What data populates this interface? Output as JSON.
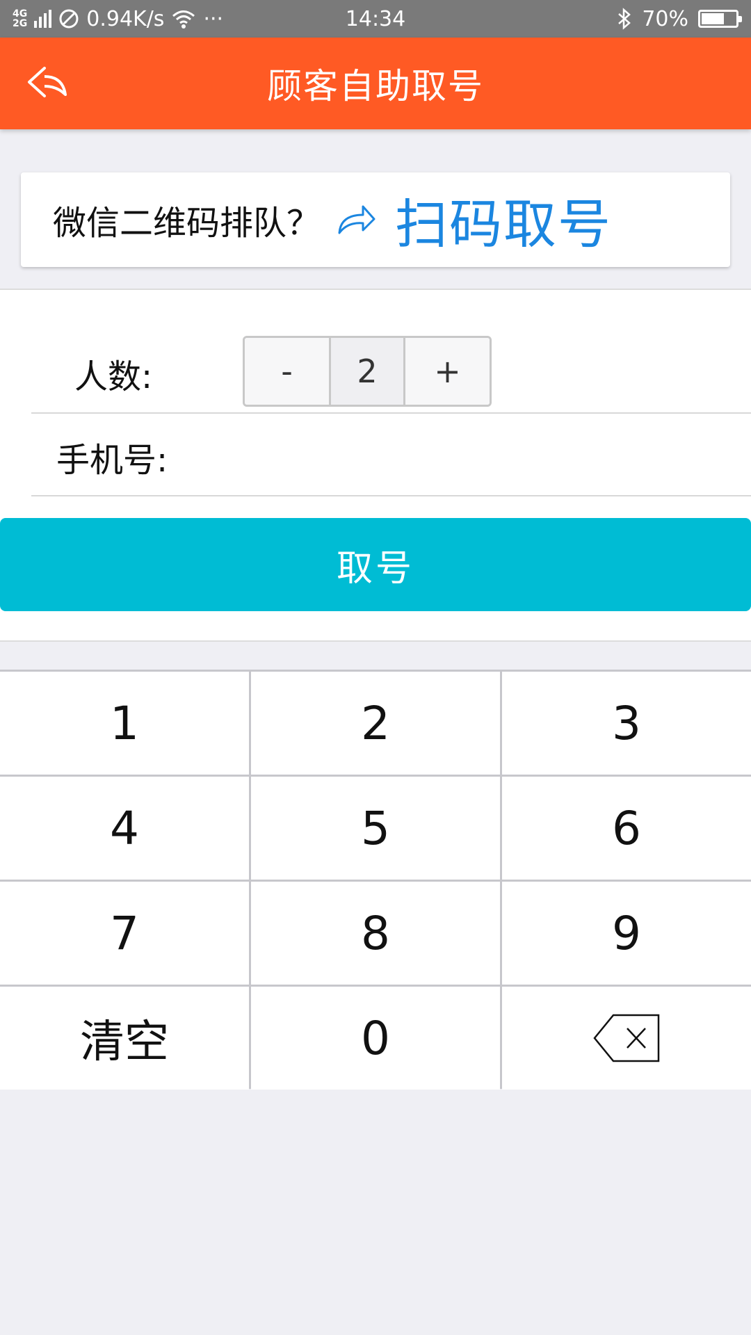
{
  "status_bar": {
    "network_top": "4G",
    "network_bottom": "2G",
    "speed": "0.94K/s",
    "more": "···",
    "time": "14:34",
    "bluetooth_icon": "bluetooth-icon",
    "battery_percent": "70%",
    "battery_level": 0.7
  },
  "nav": {
    "back_icon": "back-arrow-icon",
    "title": "顾客自助取号"
  },
  "scan": {
    "hint": "微信二维码排队？",
    "arrow_icon": "share-arrow-icon",
    "link_label": "扫码取号",
    "link_color": "#1b86e0"
  },
  "form": {
    "people_label": "人数:",
    "decrement_label": "-",
    "people_count": "2",
    "increment_label": "+",
    "phone_label": "手机号:",
    "phone_value": "",
    "submit_label": "取号"
  },
  "keypad": {
    "keys": [
      "1",
      "2",
      "3",
      "4",
      "5",
      "6",
      "7",
      "8",
      "9"
    ],
    "clear_label": "清空",
    "zero_label": "0",
    "backspace_icon": "backspace-icon"
  },
  "colors": {
    "nav_bg": "#ff5a24",
    "submit_bg": "#00bcd4",
    "page_bg": "#efeff4"
  }
}
